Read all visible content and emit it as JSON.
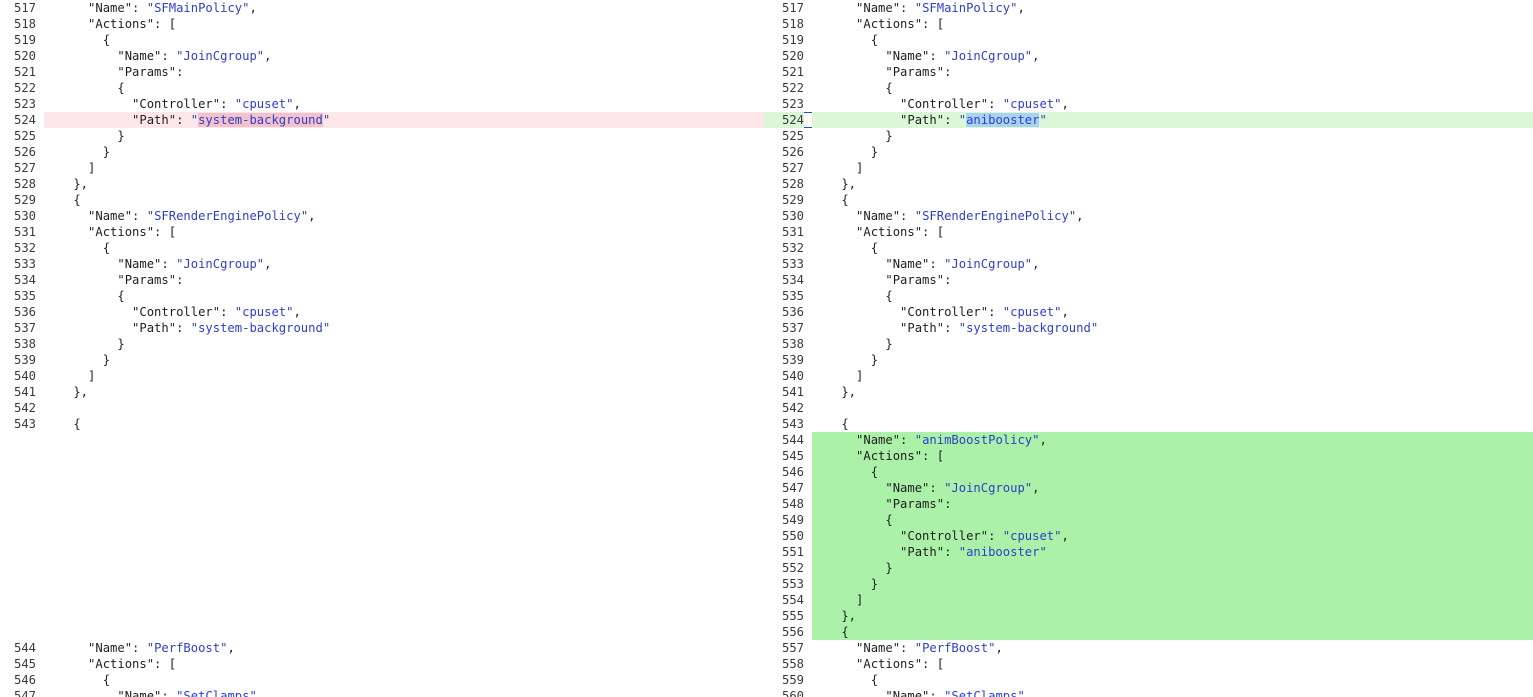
{
  "left": {
    "rows": [
      {
        "n": "517",
        "kind": "normal",
        "tokens": [
          {
            "t": "      \"Name\": "
          },
          {
            "t": "\"SFMainPolicy\"",
            "c": "s"
          },
          {
            "t": ","
          }
        ]
      },
      {
        "n": "518",
        "kind": "normal",
        "tokens": [
          {
            "t": "      \"Actions\": ["
          }
        ]
      },
      {
        "n": "519",
        "kind": "normal",
        "tokens": [
          {
            "t": "        {"
          }
        ]
      },
      {
        "n": "520",
        "kind": "normal",
        "tokens": [
          {
            "t": "          \"Name\": "
          },
          {
            "t": "\"JoinCgroup\"",
            "c": "s"
          },
          {
            "t": ","
          }
        ]
      },
      {
        "n": "521",
        "kind": "normal",
        "tokens": [
          {
            "t": "          \"Params\":"
          }
        ]
      },
      {
        "n": "522",
        "kind": "normal",
        "tokens": [
          {
            "t": "          {"
          }
        ]
      },
      {
        "n": "523",
        "kind": "normal",
        "tokens": [
          {
            "t": "            \"Controller\": "
          },
          {
            "t": "\"cpuset\"",
            "c": "s"
          },
          {
            "t": ","
          }
        ]
      },
      {
        "n": "524",
        "kind": "removed",
        "tokens": [
          {
            "t": "            \"Path\": "
          },
          {
            "t": "\"",
            "c": "s"
          },
          {
            "t": "system-background",
            "c": "s hl-del"
          },
          {
            "t": "\"",
            "c": "s"
          }
        ]
      },
      {
        "n": "525",
        "kind": "normal",
        "tokens": [
          {
            "t": "          }"
          }
        ]
      },
      {
        "n": "526",
        "kind": "normal",
        "tokens": [
          {
            "t": "        }"
          }
        ]
      },
      {
        "n": "527",
        "kind": "normal",
        "tokens": [
          {
            "t": "      ]"
          }
        ]
      },
      {
        "n": "528",
        "kind": "normal",
        "tokens": [
          {
            "t": "    },"
          }
        ]
      },
      {
        "n": "529",
        "kind": "normal",
        "tokens": [
          {
            "t": "    {"
          }
        ]
      },
      {
        "n": "530",
        "kind": "normal",
        "tokens": [
          {
            "t": "      \"Name\": "
          },
          {
            "t": "\"SFRenderEnginePolicy\"",
            "c": "s"
          },
          {
            "t": ","
          }
        ]
      },
      {
        "n": "531",
        "kind": "normal",
        "tokens": [
          {
            "t": "      \"Actions\": ["
          }
        ]
      },
      {
        "n": "532",
        "kind": "normal",
        "tokens": [
          {
            "t": "        {"
          }
        ]
      },
      {
        "n": "533",
        "kind": "normal",
        "tokens": [
          {
            "t": "          \"Name\": "
          },
          {
            "t": "\"JoinCgroup\"",
            "c": "s"
          },
          {
            "t": ","
          }
        ]
      },
      {
        "n": "534",
        "kind": "normal",
        "tokens": [
          {
            "t": "          \"Params\":"
          }
        ]
      },
      {
        "n": "535",
        "kind": "normal",
        "tokens": [
          {
            "t": "          {"
          }
        ]
      },
      {
        "n": "536",
        "kind": "normal",
        "tokens": [
          {
            "t": "            \"Controller\": "
          },
          {
            "t": "\"cpuset\"",
            "c": "s"
          },
          {
            "t": ","
          }
        ]
      },
      {
        "n": "537",
        "kind": "normal",
        "tokens": [
          {
            "t": "            \"Path\": "
          },
          {
            "t": "\"system-background\"",
            "c": "s"
          }
        ]
      },
      {
        "n": "538",
        "kind": "normal",
        "tokens": [
          {
            "t": "          }"
          }
        ]
      },
      {
        "n": "539",
        "kind": "normal",
        "tokens": [
          {
            "t": "        }"
          }
        ]
      },
      {
        "n": "540",
        "kind": "normal",
        "tokens": [
          {
            "t": "      ]"
          }
        ]
      },
      {
        "n": "541",
        "kind": "normal",
        "tokens": [
          {
            "t": "    },"
          }
        ]
      },
      {
        "n": "542",
        "kind": "normal",
        "tokens": [
          {
            "t": ""
          }
        ]
      },
      {
        "n": "543",
        "kind": "normal",
        "tokens": [
          {
            "t": "    {"
          }
        ]
      },
      {
        "n": "",
        "kind": "placeholder",
        "tokens": []
      },
      {
        "n": "",
        "kind": "placeholder",
        "tokens": []
      },
      {
        "n": "",
        "kind": "placeholder",
        "tokens": []
      },
      {
        "n": "",
        "kind": "placeholder",
        "tokens": []
      },
      {
        "n": "",
        "kind": "placeholder",
        "tokens": []
      },
      {
        "n": "",
        "kind": "placeholder",
        "tokens": []
      },
      {
        "n": "",
        "kind": "placeholder",
        "tokens": []
      },
      {
        "n": "",
        "kind": "placeholder",
        "tokens": []
      },
      {
        "n": "",
        "kind": "placeholder",
        "tokens": []
      },
      {
        "n": "",
        "kind": "placeholder",
        "tokens": []
      },
      {
        "n": "",
        "kind": "placeholder",
        "tokens": []
      },
      {
        "n": "",
        "kind": "placeholder",
        "tokens": []
      },
      {
        "n": "",
        "kind": "placeholder",
        "tokens": []
      },
      {
        "n": "544",
        "kind": "normal",
        "tokens": [
          {
            "t": "      \"Name\": "
          },
          {
            "t": "\"PerfBoost\"",
            "c": "s"
          },
          {
            "t": ","
          }
        ]
      },
      {
        "n": "545",
        "kind": "normal",
        "tokens": [
          {
            "t": "      \"Actions\": ["
          }
        ]
      },
      {
        "n": "546",
        "kind": "normal",
        "tokens": [
          {
            "t": "        {"
          }
        ]
      },
      {
        "n": "547",
        "kind": "normal",
        "tokens": [
          {
            "t": "          \"Name\": "
          },
          {
            "t": "\"SetClamps\"",
            "c": "s"
          },
          {
            "t": ","
          }
        ]
      }
    ]
  },
  "right": {
    "rows": [
      {
        "n": "517",
        "kind": "normal",
        "tokens": [
          {
            "t": "      \"Name\": "
          },
          {
            "t": "\"SFMainPolicy\"",
            "c": "s"
          },
          {
            "t": ","
          }
        ]
      },
      {
        "n": "518",
        "kind": "normal",
        "tokens": [
          {
            "t": "      \"Actions\": ["
          }
        ]
      },
      {
        "n": "519",
        "kind": "normal",
        "tokens": [
          {
            "t": "        {"
          }
        ]
      },
      {
        "n": "520",
        "kind": "normal",
        "tokens": [
          {
            "t": "          \"Name\": "
          },
          {
            "t": "\"JoinCgroup\"",
            "c": "s"
          },
          {
            "t": ","
          }
        ]
      },
      {
        "n": "521",
        "kind": "normal",
        "tokens": [
          {
            "t": "          \"Params\":"
          }
        ]
      },
      {
        "n": "522",
        "kind": "normal",
        "tokens": [
          {
            "t": "          {"
          }
        ]
      },
      {
        "n": "523",
        "kind": "normal",
        "tokens": [
          {
            "t": "            \"Controller\": "
          },
          {
            "t": "\"cpuset\"",
            "c": "s"
          },
          {
            "t": ","
          }
        ]
      },
      {
        "n": "524",
        "kind": "modified",
        "selected": true,
        "tokens": [
          {
            "t": "            \"Path\": "
          },
          {
            "t": "\"",
            "c": "s"
          },
          {
            "t": "anibooster",
            "c": "s hl-add"
          },
          {
            "t": "\"",
            "c": "s"
          }
        ]
      },
      {
        "n": "525",
        "kind": "normal",
        "tokens": [
          {
            "t": "          }"
          }
        ]
      },
      {
        "n": "526",
        "kind": "normal",
        "tokens": [
          {
            "t": "        }"
          }
        ]
      },
      {
        "n": "527",
        "kind": "normal",
        "tokens": [
          {
            "t": "      ]"
          }
        ]
      },
      {
        "n": "528",
        "kind": "normal",
        "tokens": [
          {
            "t": "    },"
          }
        ]
      },
      {
        "n": "529",
        "kind": "normal",
        "tokens": [
          {
            "t": "    {"
          }
        ]
      },
      {
        "n": "530",
        "kind": "normal",
        "tokens": [
          {
            "t": "      \"Name\": "
          },
          {
            "t": "\"SFRenderEnginePolicy\"",
            "c": "s"
          },
          {
            "t": ","
          }
        ]
      },
      {
        "n": "531",
        "kind": "normal",
        "tokens": [
          {
            "t": "      \"Actions\": ["
          }
        ]
      },
      {
        "n": "532",
        "kind": "normal",
        "tokens": [
          {
            "t": "        {"
          }
        ]
      },
      {
        "n": "533",
        "kind": "normal",
        "tokens": [
          {
            "t": "          \"Name\": "
          },
          {
            "t": "\"JoinCgroup\"",
            "c": "s"
          },
          {
            "t": ","
          }
        ]
      },
      {
        "n": "534",
        "kind": "normal",
        "tokens": [
          {
            "t": "          \"Params\":"
          }
        ]
      },
      {
        "n": "535",
        "kind": "normal",
        "tokens": [
          {
            "t": "          {"
          }
        ]
      },
      {
        "n": "536",
        "kind": "normal",
        "tokens": [
          {
            "t": "            \"Controller\": "
          },
          {
            "t": "\"cpuset\"",
            "c": "s"
          },
          {
            "t": ","
          }
        ]
      },
      {
        "n": "537",
        "kind": "normal",
        "tokens": [
          {
            "t": "            \"Path\": "
          },
          {
            "t": "\"system-background\"",
            "c": "s"
          }
        ]
      },
      {
        "n": "538",
        "kind": "normal",
        "tokens": [
          {
            "t": "          }"
          }
        ]
      },
      {
        "n": "539",
        "kind": "normal",
        "tokens": [
          {
            "t": "        }"
          }
        ]
      },
      {
        "n": "540",
        "kind": "normal",
        "tokens": [
          {
            "t": "      ]"
          }
        ]
      },
      {
        "n": "541",
        "kind": "normal",
        "tokens": [
          {
            "t": "    },"
          }
        ]
      },
      {
        "n": "542",
        "kind": "normal",
        "tokens": [
          {
            "t": ""
          }
        ]
      },
      {
        "n": "543",
        "kind": "normal",
        "tokens": [
          {
            "t": "    {"
          }
        ]
      },
      {
        "n": "544",
        "kind": "added",
        "tokens": [
          {
            "t": "      \"Name\": "
          },
          {
            "t": "\"animBoostPolicy\"",
            "c": "s"
          },
          {
            "t": ","
          }
        ]
      },
      {
        "n": "545",
        "kind": "added",
        "tokens": [
          {
            "t": "      \"Actions\": ["
          }
        ]
      },
      {
        "n": "546",
        "kind": "added",
        "tokens": [
          {
            "t": "        {"
          }
        ]
      },
      {
        "n": "547",
        "kind": "added",
        "tokens": [
          {
            "t": "          \"Name\": "
          },
          {
            "t": "\"JoinCgroup\"",
            "c": "s"
          },
          {
            "t": ","
          }
        ]
      },
      {
        "n": "548",
        "kind": "added",
        "tokens": [
          {
            "t": "          \"Params\":"
          }
        ]
      },
      {
        "n": "549",
        "kind": "added",
        "tokens": [
          {
            "t": "          {"
          }
        ]
      },
      {
        "n": "550",
        "kind": "added",
        "tokens": [
          {
            "t": "            \"Controller\": "
          },
          {
            "t": "\"cpuset\"",
            "c": "s"
          },
          {
            "t": ","
          }
        ]
      },
      {
        "n": "551",
        "kind": "added",
        "tokens": [
          {
            "t": "            \"Path\": "
          },
          {
            "t": "\"anibooster\"",
            "c": "s"
          }
        ]
      },
      {
        "n": "552",
        "kind": "added",
        "tokens": [
          {
            "t": "          }"
          }
        ]
      },
      {
        "n": "553",
        "kind": "added",
        "tokens": [
          {
            "t": "        }"
          }
        ]
      },
      {
        "n": "554",
        "kind": "added",
        "tokens": [
          {
            "t": "      ]"
          }
        ]
      },
      {
        "n": "555",
        "kind": "added",
        "tokens": [
          {
            "t": "    },"
          }
        ]
      },
      {
        "n": "556",
        "kind": "added",
        "tokens": [
          {
            "t": "    {"
          }
        ]
      },
      {
        "n": "557",
        "kind": "normal",
        "tokens": [
          {
            "t": "      \"Name\": "
          },
          {
            "t": "\"PerfBoost\"",
            "c": "s"
          },
          {
            "t": ","
          }
        ]
      },
      {
        "n": "558",
        "kind": "normal",
        "tokens": [
          {
            "t": "      \"Actions\": ["
          }
        ]
      },
      {
        "n": "559",
        "kind": "normal",
        "tokens": [
          {
            "t": "        {"
          }
        ]
      },
      {
        "n": "560",
        "kind": "normal",
        "tokens": [
          {
            "t": "          \"Name\": "
          },
          {
            "t": "\"SetClamps\"",
            "c": "s"
          },
          {
            "t": ","
          }
        ]
      }
    ]
  }
}
